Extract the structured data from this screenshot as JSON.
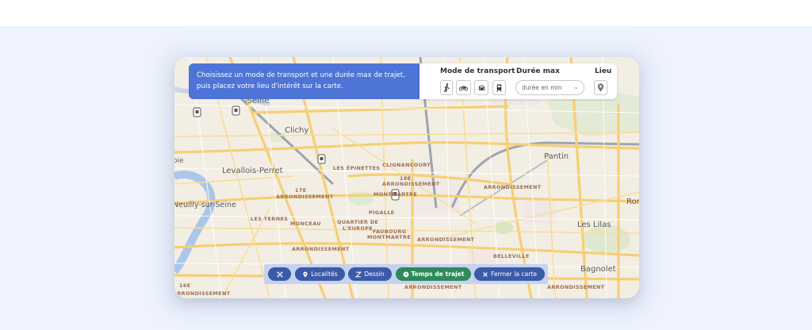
{
  "instructions": "Choisissez un mode de transport et une durée max de trajet, puis placez votre lieu d'intérêt sur la carte.",
  "controls": {
    "mode_title": "Mode de transport",
    "duration_title": "Durée max",
    "duration_value": "durée en min",
    "lieu_title": "Lieu",
    "modes": [
      "walk-icon",
      "bike-icon",
      "car-icon",
      "transit-icon"
    ]
  },
  "toolbar": {
    "expand_icon": "expand-icon",
    "localites": "Localités",
    "dessin": "Dessin",
    "temps": "Temps de trajet",
    "fermer": "Fermer la carte"
  },
  "map": {
    "places": {
      "seine_top": "-Seine",
      "clichy": "Clichy",
      "levallois": "Levallois-Perret",
      "neuilly": "Neuilly-sur-Seine",
      "pantin": "Pantin",
      "lilas": "Les Lilas",
      "bagnolet": "Bagnolet",
      "rom": "Rom",
      "boie": "oie"
    },
    "districts": {
      "epinettes": "LES ÉPINETTES",
      "clignancourt": "CLIGNANCOURT",
      "arr18_a": "18E",
      "arr18_b": "ARRONDISSEMENT",
      "montmartre": "MONTMARTRE",
      "arr17_a": "17E",
      "arr17_b": "ARRONDISSEMENT",
      "arr19": "ARRONDISSEMENT",
      "ternes": "LES TERNES",
      "monceau": "MONCEAU",
      "europe_a": "QUARTIER DE",
      "europe_b": "L'EUROPE",
      "pigalle": "PIGALLE",
      "faubourg_a": "FAUBOURG",
      "faubourg_b": "MONTMARTRE",
      "arr_mid": "ARRONDISSEMENT",
      "arr_low": "ARRONDISSEMENT",
      "belleville": "BELLEVILLE",
      "arr_left_low": "ARRONDISSEMENT",
      "arr16_a": "16E",
      "arr16_b": "ARRONDISSEMENT",
      "arr_bottom": "ARRONDISSEMENT"
    }
  },
  "colors": {
    "banner": "#4d74d6",
    "toolbar_button": "#3b5aa8",
    "toolbar_active": "#2e8a5a",
    "background": "#eef3fd"
  }
}
